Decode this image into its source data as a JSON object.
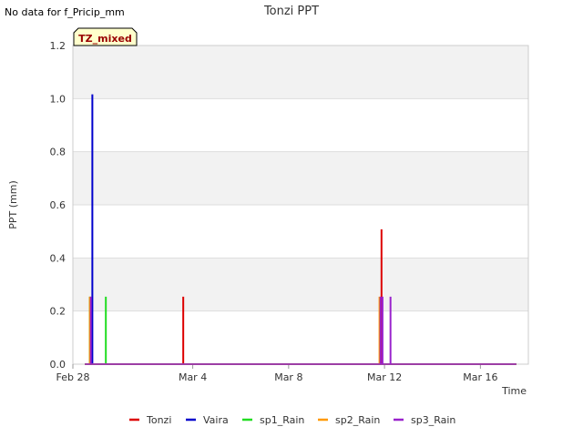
{
  "notice": "No data for f_Pricip_mm",
  "badge": "TZ_mixed",
  "colors": {
    "Tonzi": "#dd0000",
    "Vaira": "#0000cc",
    "sp1_Rain": "#22dd22",
    "sp2_Rain": "#ff9900",
    "sp3_Rain": "#9922cc",
    "band": "#f2f2f2",
    "badge_bg": "#ffffcc"
  },
  "chart_data": {
    "type": "line",
    "title": "Tonzi PPT",
    "xlabel": "Time",
    "ylabel": "PPT (mm)",
    "xlim": [
      "2024-02-28",
      "2024-03-18"
    ],
    "ylim": [
      0,
      1.2
    ],
    "x_ticks": [
      {
        "date": "2024-02-28",
        "label": "Feb 28"
      },
      {
        "date": "2024-03-04",
        "label": "Mar 4"
      },
      {
        "date": "2024-03-08",
        "label": "Mar 8"
      },
      {
        "date": "2024-03-12",
        "label": "Mar 12"
      },
      {
        "date": "2024-03-16",
        "label": "Mar 16"
      }
    ],
    "y_ticks": [
      0.0,
      0.2,
      0.4,
      0.6,
      0.8,
      1.0,
      1.2
    ],
    "y_tick_labels": [
      "0.0",
      "0.2",
      "0.4",
      "0.6",
      "0.8",
      "1.0",
      "1.2"
    ],
    "baseline_range": [
      "2024-02-28T12:00",
      "2024-03-17T12:00"
    ],
    "legend_position": "bottom",
    "series": [
      {
        "name": "Tonzi",
        "color_key": "Tonzi",
        "spikes": [
          {
            "x": "2024-03-03T14:30",
            "y": 0.254
          },
          {
            "x": "2024-03-11T21:00",
            "y": 0.508
          }
        ]
      },
      {
        "name": "Vaira",
        "color_key": "Vaira",
        "spikes": [
          {
            "x": "2024-02-28T19:30",
            "y": 1.016
          }
        ]
      },
      {
        "name": "sp1_Rain",
        "color_key": "sp1_Rain",
        "spikes": [
          {
            "x": "2024-02-29T09:00",
            "y": 0.254
          },
          {
            "x": "2024-02-28T17:00",
            "y": 0.254
          }
        ]
      },
      {
        "name": "sp2_Rain",
        "color_key": "sp2_Rain",
        "spikes": [
          {
            "x": "2024-02-28T17:00",
            "y": 0.254
          },
          {
            "x": "2024-03-11T19:00",
            "y": 0.254
          }
        ]
      },
      {
        "name": "sp3_Rain",
        "color_key": "sp3_Rain",
        "spikes": [
          {
            "x": "2024-02-28T18:00",
            "y": 0.254
          },
          {
            "x": "2024-03-11T20:00",
            "y": 0.254
          },
          {
            "x": "2024-03-11T22:00",
            "y": 0.254
          },
          {
            "x": "2024-03-12T06:00",
            "y": 0.254
          }
        ]
      }
    ]
  }
}
